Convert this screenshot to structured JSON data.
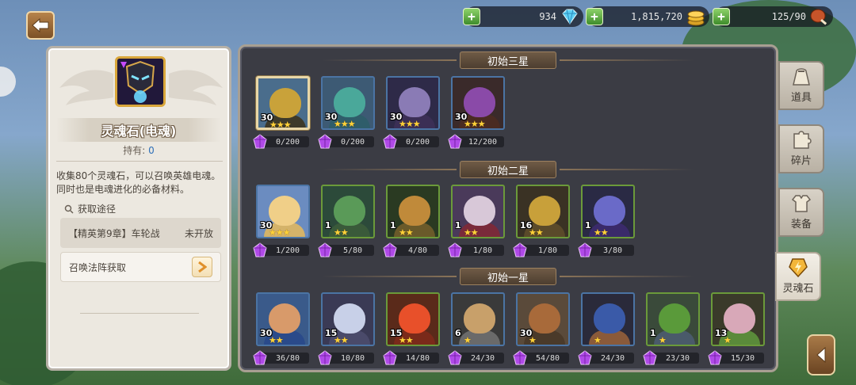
{
  "resources": [
    {
      "value": "934",
      "icon": "diamond-icon"
    },
    {
      "value": "1,815,720",
      "icon": "gold-coin-icon"
    },
    {
      "value": "125/90",
      "icon": "meat-stamina-icon"
    }
  ],
  "item": {
    "name": "灵魂石(电魂)",
    "own_label": "持有:",
    "own_count": "0",
    "description": "收集80个灵魂石，可以召唤英雄电魂。同时也是电魂进化的必备材料。",
    "route_title": "获取途径",
    "routes": [
      {
        "label": "【精英第9章】车轮战",
        "status": "未开放"
      },
      {
        "label": "召唤法阵获取"
      }
    ]
  },
  "sections": [
    {
      "title": "初始三星",
      "cards": [
        {
          "level": "30",
          "stars": "★★★",
          "progress": "0/200",
          "selected": true,
          "head": "#c9a23a",
          "bodycolor": "#3d3a2a",
          "bg": "#4a6d8c"
        },
        {
          "level": "30",
          "stars": "★★★",
          "progress": "0/200",
          "head": "#4aa89a",
          "bodycolor": "#2f5d6a",
          "bg": "#3d5a74"
        },
        {
          "level": "30",
          "stars": "★★★",
          "progress": "0/200",
          "head": "#8a7bb5",
          "bodycolor": "#3b2f55",
          "bg": "#2e2a48"
        },
        {
          "level": "30",
          "stars": "★★★",
          "progress": "12/200",
          "head": "#8a4aa8",
          "bodycolor": "#4a2b22",
          "bg": "#3a2a2a"
        }
      ]
    },
    {
      "title": "初始二星",
      "cards": [
        {
          "level": "30",
          "stars": "★★★",
          "progress": "1/200",
          "head": "#f0cf88",
          "bodycolor": "#d4b36a",
          "bg": "#6b8cc0"
        },
        {
          "level": "1",
          "stars": "★★",
          "progress": "5/80",
          "head": "#5a9a58",
          "bodycolor": "#3a5a3a",
          "bg": "#2c4a3a",
          "green": true
        },
        {
          "level": "1",
          "stars": "★★",
          "progress": "4/80",
          "head": "#c08a3a",
          "bodycolor": "#6a5a2a",
          "bg": "#2a3a22",
          "green": true
        },
        {
          "level": "1",
          "stars": "★★",
          "progress": "1/80",
          "head": "#d8c8d8",
          "bodycolor": "#7a2a3a",
          "bg": "#4a3a5a",
          "green": true
        },
        {
          "level": "16",
          "stars": "★★",
          "progress": "1/80",
          "head": "#c8a03a",
          "bodycolor": "#5a4a2a",
          "bg": "#3a3224",
          "green": true
        },
        {
          "level": "1",
          "stars": "★★",
          "progress": "3/80",
          "head": "#6a6ac8",
          "bodycolor": "#3a2a6a",
          "bg": "#2a2a44",
          "green": true
        }
      ]
    },
    {
      "title": "初始一星",
      "cards": [
        {
          "level": "30",
          "stars": "★★",
          "progress": "36/80",
          "head": "#d89a6a",
          "bodycolor": "#2a4a8a",
          "bg": "#3a5a8a"
        },
        {
          "level": "15",
          "stars": "★★",
          "progress": "10/80",
          "head": "#c8d0e8",
          "bodycolor": "#4a4a6a",
          "bg": "#3a3a55"
        },
        {
          "level": "15",
          "stars": "★★",
          "progress": "14/80",
          "head": "#e8502a",
          "bodycolor": "#7a2a1a",
          "bg": "#5a2a1a",
          "green": true
        },
        {
          "level": "6",
          "stars": "★",
          "progress": "24/30",
          "head": "#c8a06a",
          "bodycolor": "#6a6a6a",
          "bg": "#3a3a3a"
        },
        {
          "level": "30",
          "stars": "★",
          "progress": "54/80",
          "head": "#a86a3a",
          "bodycolor": "#4a3a2a",
          "bg": "#5a4a3a"
        },
        {
          "level": "",
          "stars": "★",
          "progress": "24/30",
          "head": "#3a5aa8",
          "bodycolor": "#8a5a3a",
          "bg": "#2a2a3a"
        },
        {
          "level": "1",
          "stars": "★",
          "progress": "23/30",
          "head": "#5a9a3a",
          "bodycolor": "#4a5a6a",
          "bg": "#3a4a3a",
          "green": true
        },
        {
          "level": "13",
          "stars": "★",
          "progress": "15/30",
          "head": "#d8a8b8",
          "bodycolor": "#5a8a3a",
          "bg": "#3a3a2a",
          "green": true
        }
      ]
    }
  ],
  "tabs": [
    {
      "label": "道具",
      "icon": "bag-icon"
    },
    {
      "label": "碎片",
      "icon": "puzzle-icon"
    },
    {
      "label": "装备",
      "icon": "armor-icon"
    },
    {
      "label": "灵魂石",
      "icon": "soul-stone-icon",
      "active": true
    }
  ]
}
